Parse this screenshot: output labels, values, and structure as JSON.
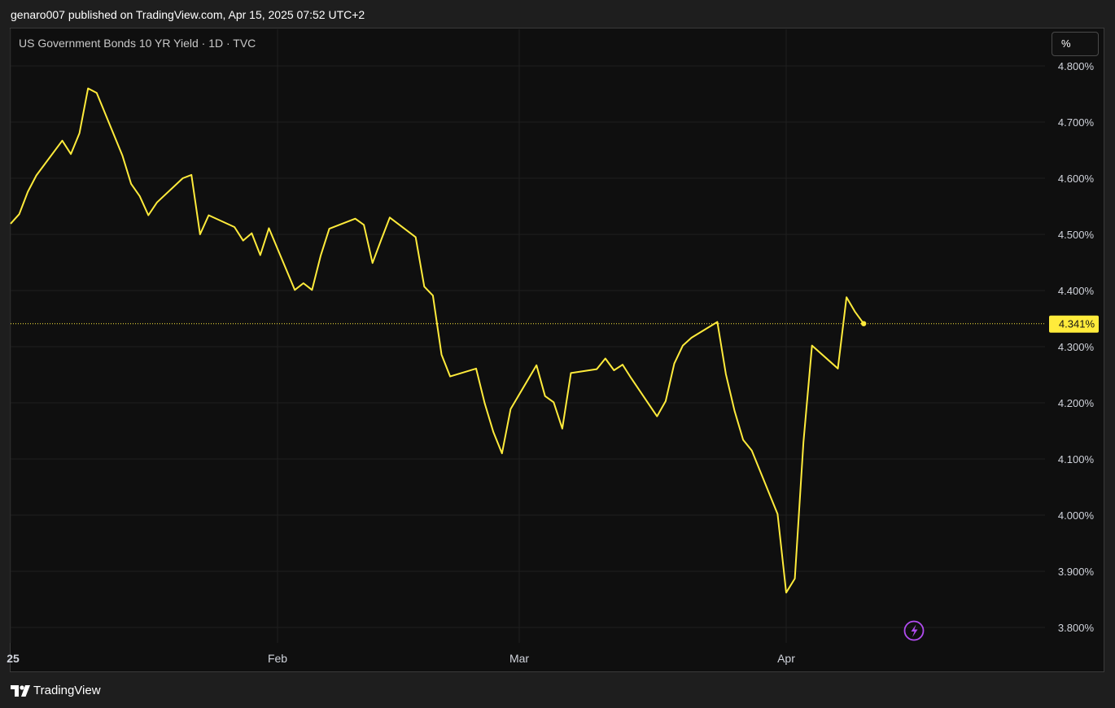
{
  "header": {
    "publish_line": "genaro007 published on TradingView.com, Apr 15, 2025 07:52 UTC+2"
  },
  "symbol": {
    "title": "US Government Bonds 10 YR Yield · 1D · TVC"
  },
  "scale": {
    "unit_label": "%"
  },
  "footer": {
    "brand": "TradingView"
  },
  "colors": {
    "line": "#ffeb3b",
    "background": "#0f0f0f",
    "grid": "#1f1f1f",
    "axis_text": "#d1d4dc",
    "price_tag": "#ffeb3b"
  },
  "icons": {
    "alert": "lightning-icon",
    "logo": "tradingview-logo-icon"
  },
  "chart_data": {
    "type": "line",
    "title": "US Government Bonds 10 YR Yield · 1D · TVC",
    "ylim": [
      3.76,
      4.82
    ],
    "y_ticks": [
      "4.800%",
      "4.700%",
      "4.600%",
      "4.500%",
      "4.400%",
      "4.300%",
      "4.200%",
      "4.100%",
      "4.000%",
      "3.900%",
      "3.800%"
    ],
    "y_tick_values": [
      4.8,
      4.7,
      4.6,
      4.5,
      4.4,
      4.3,
      4.2,
      4.1,
      4.0,
      3.9,
      3.8
    ],
    "x_ticks": [
      "25",
      "Feb",
      "Mar",
      "Apr"
    ],
    "x_tick_dates": [
      "2025-01-01",
      "2025-02-01",
      "2025-03-01",
      "2025-04-01"
    ],
    "xlim": [
      "2025-01-01",
      "2025-04-30"
    ],
    "last_value": 4.341,
    "last_value_label": "4.341%",
    "grid": true,
    "series": [
      {
        "color": "#ffeb3b",
        "points": [
          [
            "2025-01-01",
            4.519
          ],
          [
            "2025-01-02",
            4.536
          ],
          [
            "2025-01-03",
            4.576
          ],
          [
            "2025-01-04",
            4.605
          ],
          [
            "2025-01-07",
            4.667
          ],
          [
            "2025-01-08",
            4.643
          ],
          [
            "2025-01-09",
            4.68
          ],
          [
            "2025-01-10",
            4.76
          ],
          [
            "2025-01-11",
            4.752
          ],
          [
            "2025-01-14",
            4.64
          ],
          [
            "2025-01-15",
            4.59
          ],
          [
            "2025-01-16",
            4.568
          ],
          [
            "2025-01-17",
            4.534
          ],
          [
            "2025-01-18",
            4.557
          ],
          [
            "2025-01-21",
            4.6
          ],
          [
            "2025-01-22",
            4.606
          ],
          [
            "2025-01-23",
            4.5
          ],
          [
            "2025-01-24",
            4.534
          ],
          [
            "2025-01-27",
            4.513
          ],
          [
            "2025-01-28",
            4.489
          ],
          [
            "2025-01-29",
            4.502
          ],
          [
            "2025-01-30",
            4.463
          ],
          [
            "2025-01-31",
            4.511
          ],
          [
            "2025-02-03",
            4.401
          ],
          [
            "2025-02-04",
            4.413
          ],
          [
            "2025-02-05",
            4.401
          ],
          [
            "2025-02-06",
            4.462
          ],
          [
            "2025-02-07",
            4.51
          ],
          [
            "2025-02-10",
            4.528
          ],
          [
            "2025-02-11",
            4.517
          ],
          [
            "2025-02-12",
            4.449
          ],
          [
            "2025-02-13",
            4.49
          ],
          [
            "2025-02-14",
            4.53
          ],
          [
            "2025-02-17",
            4.495
          ],
          [
            "2025-02-18",
            4.407
          ],
          [
            "2025-02-19",
            4.391
          ],
          [
            "2025-02-20",
            4.286
          ],
          [
            "2025-02-21",
            4.247
          ],
          [
            "2025-02-24",
            4.261
          ],
          [
            "2025-02-25",
            4.199
          ],
          [
            "2025-02-26",
            4.148
          ],
          [
            "2025-02-27",
            4.11
          ],
          [
            "2025-02-28",
            4.189
          ],
          [
            "2025-03-03",
            4.267
          ],
          [
            "2025-03-04",
            4.212
          ],
          [
            "2025-03-05",
            4.201
          ],
          [
            "2025-03-06",
            4.154
          ],
          [
            "2025-03-07",
            4.253
          ],
          [
            "2025-03-10",
            4.26
          ],
          [
            "2025-03-11",
            4.279
          ],
          [
            "2025-03-12",
            4.258
          ],
          [
            "2025-03-13",
            4.268
          ],
          [
            "2025-03-14",
            4.244
          ],
          [
            "2025-03-17",
            4.176
          ],
          [
            "2025-03-18",
            4.203
          ],
          [
            "2025-03-19",
            4.27
          ],
          [
            "2025-03-20",
            4.302
          ],
          [
            "2025-03-21",
            4.316
          ],
          [
            "2025-03-24",
            4.344
          ],
          [
            "2025-03-25",
            4.251
          ],
          [
            "2025-03-26",
            4.186
          ],
          [
            "2025-03-27",
            4.134
          ],
          [
            "2025-03-28",
            4.115
          ],
          [
            "2025-03-31",
            4.002
          ],
          [
            "2025-04-01",
            3.862
          ],
          [
            "2025-04-02",
            3.887
          ],
          [
            "2025-04-03",
            4.13
          ],
          [
            "2025-04-04",
            4.302
          ],
          [
            "2025-04-07",
            4.261
          ],
          [
            "2025-04-08",
            4.388
          ],
          [
            "2025-04-09",
            4.362
          ],
          [
            "2025-04-10",
            4.341
          ]
        ]
      }
    ]
  }
}
